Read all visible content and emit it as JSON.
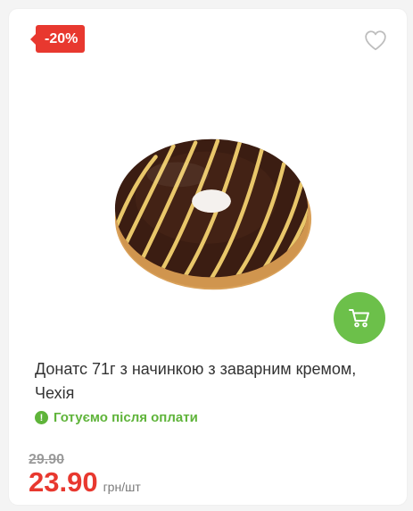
{
  "product": {
    "discount_badge": "-20%",
    "title": "Донатс 71г з начинкою з заварним кремом, Чехія",
    "status_text": "Готуємо після оплати",
    "old_price": "29.90",
    "price": "23.90",
    "unit": "грн/шт"
  },
  "icons": {
    "favorite": "heart-outline-icon",
    "cart": "cart-icon",
    "status": "exclamation-circle-icon"
  },
  "colors": {
    "discount": "#e8382f",
    "cart_button": "#6cc04a",
    "status": "#5fb43a",
    "price": "#e8382f"
  }
}
